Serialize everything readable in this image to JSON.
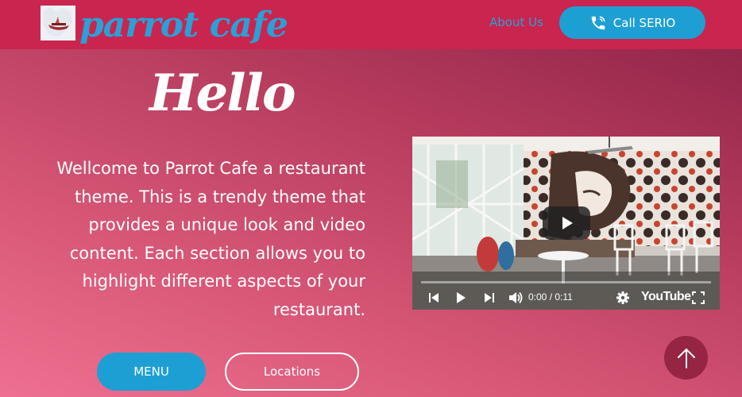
{
  "header": {
    "brand": "parrot cafe",
    "nav_about": "About Us",
    "call_label": "Call SERIO"
  },
  "hero": {
    "title": "Hello",
    "intro": "Wellcome to Parrot Cafe a restaurant theme. This is a trendy theme that provides a unique look and video content. Each section allows you to highlight different aspects of your restaurant.",
    "menu_label": "MENU",
    "locations_label": "Locations"
  },
  "video": {
    "time": "0:00 / 0:11",
    "brand_label": "YouTube",
    "progress": 0
  },
  "icons": [
    "logo-image",
    "phone-icon",
    "play-icon",
    "previous-icon",
    "next-icon",
    "volume-icon",
    "settings-icon",
    "fullscreen-icon",
    "arrow-up-icon"
  ],
  "colors": {
    "header_bg": "#c9254f",
    "accent_blue": "#1e9fd4",
    "text_white": "#ffffff"
  }
}
